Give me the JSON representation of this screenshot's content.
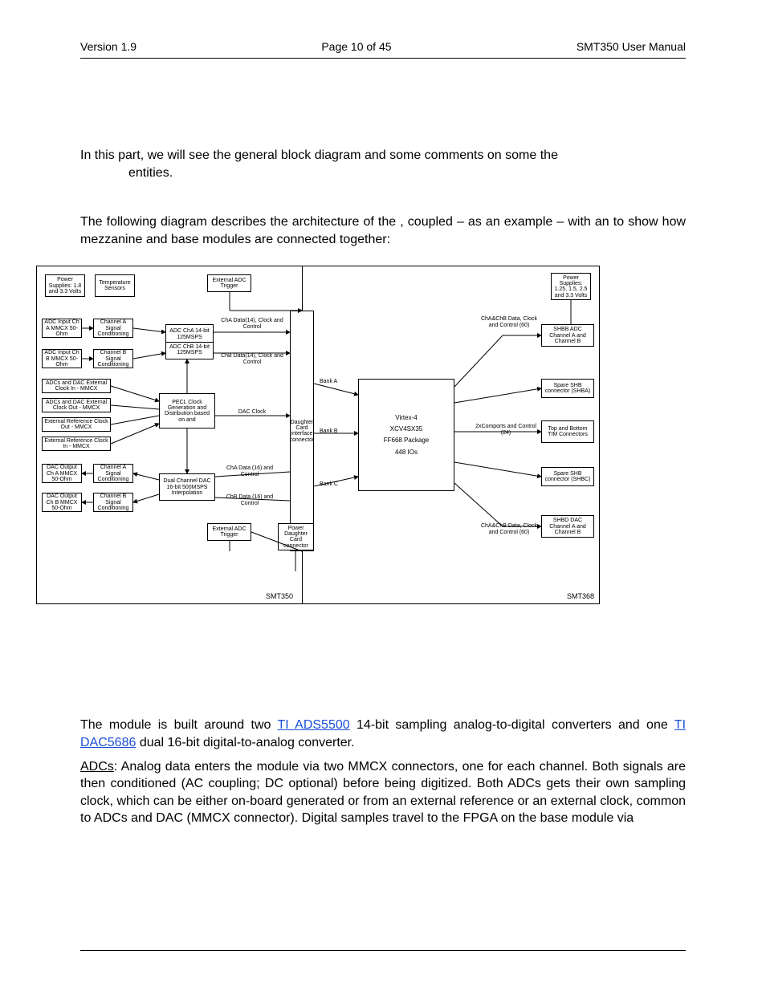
{
  "header": {
    "version": "Version 1.9",
    "page": "Page 10 of 45",
    "title": "SMT350 User Manual"
  },
  "intro": {
    "p1a": "In this part, we will see the general block diagram and some comments on some the",
    "p1b": "entities.",
    "p2a": "The following diagram describes the architecture of the ",
    "p2b": ", coupled – as an example – with an ",
    "p2c": " to show how mezzanine and base modules are connected together:"
  },
  "links": {
    "ads5500": "TI ADS5500",
    "dac5686": "TI DAC5686"
  },
  "after": {
    "p1a": "The module is built around two ",
    "p1b": " 14-bit sampling analog-to-digital converters and one ",
    "p1c": " dual 16-bit digital-to-analog converter.",
    "p2_lead": "ADCs",
    "p2": ": Analog data enters the module via two MMCX connectors, one for each channel. Both signals are then conditioned (AC coupling; DC optional) before being digitized. Both ADCs gets their own sampling clock, which can be either on-board generated or from an external reference or an external clock, common to ADCs and DAC (MMCX connector). Digital samples travel to the FPGA on the base module via"
  },
  "diagram": {
    "footer_left": "SMT350",
    "footer_right": "SMT368",
    "left_module": {
      "power": "Power Supplies: 1.8 and 3.3 Volts",
      "temp": "Temperature Sensors",
      "ext_adc_trigger": "External ADC Trigger",
      "adc_in_a": "ADC Input Ch A MMCX 50-Ohm",
      "adc_in_b": "ADC Input Ch B MMCX 50-Ohm",
      "cond_a": "Channel A Signal Conditioning",
      "cond_b": "Channel B Signal Conditioning",
      "adc_a": "ADC ChA 14-bit 125MSPS",
      "adc_b": "ADC ChB 14-bit 125MSPS",
      "cha_data": "ChA Data(14), Clock and Control",
      "chb_data": "ChB Data(14), Clock and Control",
      "ext_clk_in": "ADCs and DAC External Clock In - MMCX",
      "ext_clk_out": "ADCs and DAC External Clock Out - MMCX",
      "ext_ref_out": "External Reference Clock Out - MMCX",
      "ext_ref_in": "External Reference Clock In - MMCX",
      "pecl": "PECL Clock Generation and Distribution based on and",
      "dac_clock": "DAC Clock",
      "dac_out_a": "DAC Output Ch A MMCX 50-Ohm",
      "dac_out_b": "DAC Output Ch B MMCX 50-Ohm",
      "dac_cond_a": "Channel A Signal Conditioning",
      "dac_cond_b": "Channel B Signal Conditioning",
      "dac": "Dual Channel DAC 16-bit 500MSPS Interpolation",
      "dac_cha_data": "ChA Data (16) and Control",
      "dac_chb_data": "ChB Data (16) and Control",
      "ext_adc_trigger2": "External ADC Trigger",
      "pwr_dc": "Power Daughter Card connector",
      "dc_if": "Daughter Card interface connector",
      "bank_a": "Bank A",
      "bank_b": "Bank B",
      "bank_c": "Bank C"
    },
    "right_module": {
      "power": "Power Supplies: 1.25, 1.5, 2.5 and 3.3 Volts",
      "shbb": "SHBB ADC Channel A and Channel B",
      "shba": "Spare SHB connector (SHBA)",
      "tim": "Top and Bottom TIM Connectors",
      "shbc": "Spare SHB connector (SHBC)",
      "shbd": "SHBD DAC Channel A and Channel B",
      "fpga_l1": "Virtex-4",
      "fpga_l2": "XCV4SX35",
      "fpga_l3": "FF668 Package",
      "fpga_l4": "448 IOs",
      "adc_bus": "ChA&ChB Data, Clock and Control (60)",
      "dac_bus": "ChA&ChB Data, Clock and Control (60)",
      "comports": "2xComports and Control (24)"
    }
  }
}
